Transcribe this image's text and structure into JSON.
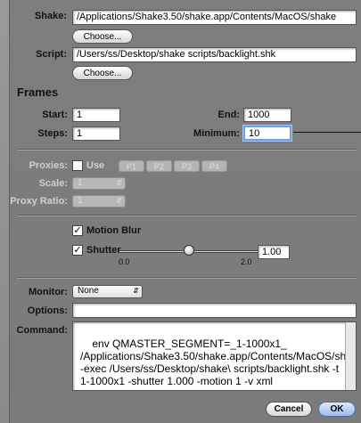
{
  "shake": {
    "label": "Shake:",
    "value": "/Applications/Shake3.50/shake.app/Contents/MacOS/shake",
    "button": "Choose..."
  },
  "script": {
    "label": "Script:",
    "value": "/Users/ss/Desktop/shake scripts/backlight.shk",
    "button": "Choose..."
  },
  "frames": {
    "header": "Frames",
    "start_label": "Start:",
    "start_value": "1",
    "end_label": "End:",
    "end_value": "1000",
    "steps_label": "Steps:",
    "steps_value": "1",
    "minimum_label": "Minimum:",
    "minimum_value": "10"
  },
  "proxies": {
    "label": "Proxies:",
    "use_label": "Use",
    "buttons": [
      "P1",
      "P2",
      "P3",
      "P4"
    ],
    "scale_label": "Scale:",
    "scale_value": "1",
    "ratio_label": "Proxy Ratio:",
    "ratio_value": "1"
  },
  "motion_blur": {
    "label": "Motion Blur",
    "shutter_label": "Shutter",
    "shutter_value": "1.00",
    "slider_min_label": "0.0",
    "slider_max_label": "2.0",
    "slider_value_fraction": 0.5
  },
  "monitor": {
    "label": "Monitor:",
    "value": "None"
  },
  "options": {
    "label": "Options:",
    "value": ""
  },
  "command": {
    "label": "Command:",
    "value": "env QMASTER_SEGMENT=_1-1000x1_ /Applications/Shake3.50/shake.app/Contents/MacOS/shake -exec /Users/ss/Desktop/shake\\ scripts/backlight.shk -t 1-1000x1 -shutter 1.000 -motion 1 -v xml"
  },
  "footer": {
    "cancel": "Cancel",
    "ok": "OK"
  }
}
